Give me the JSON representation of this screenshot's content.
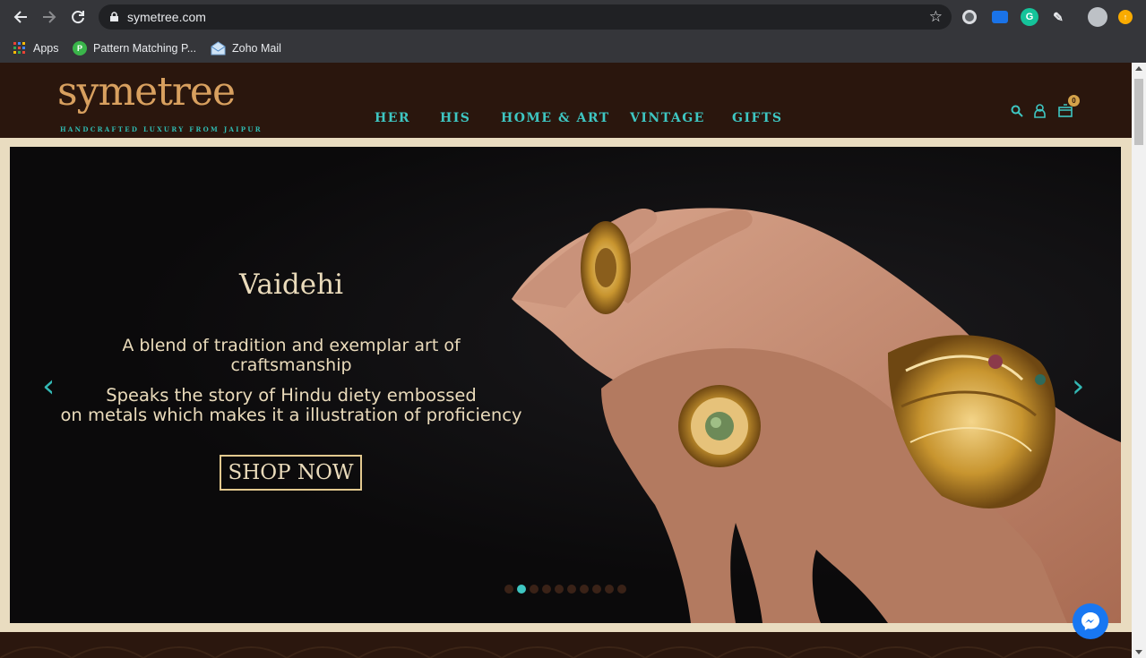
{
  "browser": {
    "url": "symetree.com",
    "bookmarks": [
      {
        "label": "Apps"
      },
      {
        "label": "Pattern Matching P..."
      },
      {
        "label": "Zoho Mail"
      }
    ]
  },
  "site": {
    "logo": "symetree",
    "tagline": "HANDCRAFTED LUXURY FROM JAIPUR",
    "nav": [
      "HER",
      "HIS",
      "HOME & ART",
      "VINTAGE",
      "GIFTS"
    ],
    "cart_count": "0"
  },
  "hero": {
    "title": "Vaidehi",
    "desc_line1": "A blend of tradition and exemplar art of",
    "desc_line2": "craftsmanship",
    "desc_line3": "Speaks the story of Hindu diety embossed",
    "desc_line4": "on metals which makes it a illustration of proficiency",
    "cta": "SHOP NOW",
    "slide_count": 10,
    "active_slide": 2
  },
  "colors": {
    "header_bg": "#2a160d",
    "accent": "#3ec6c2",
    "gold": "#d8a05f",
    "frame": "#e9dcc0"
  }
}
